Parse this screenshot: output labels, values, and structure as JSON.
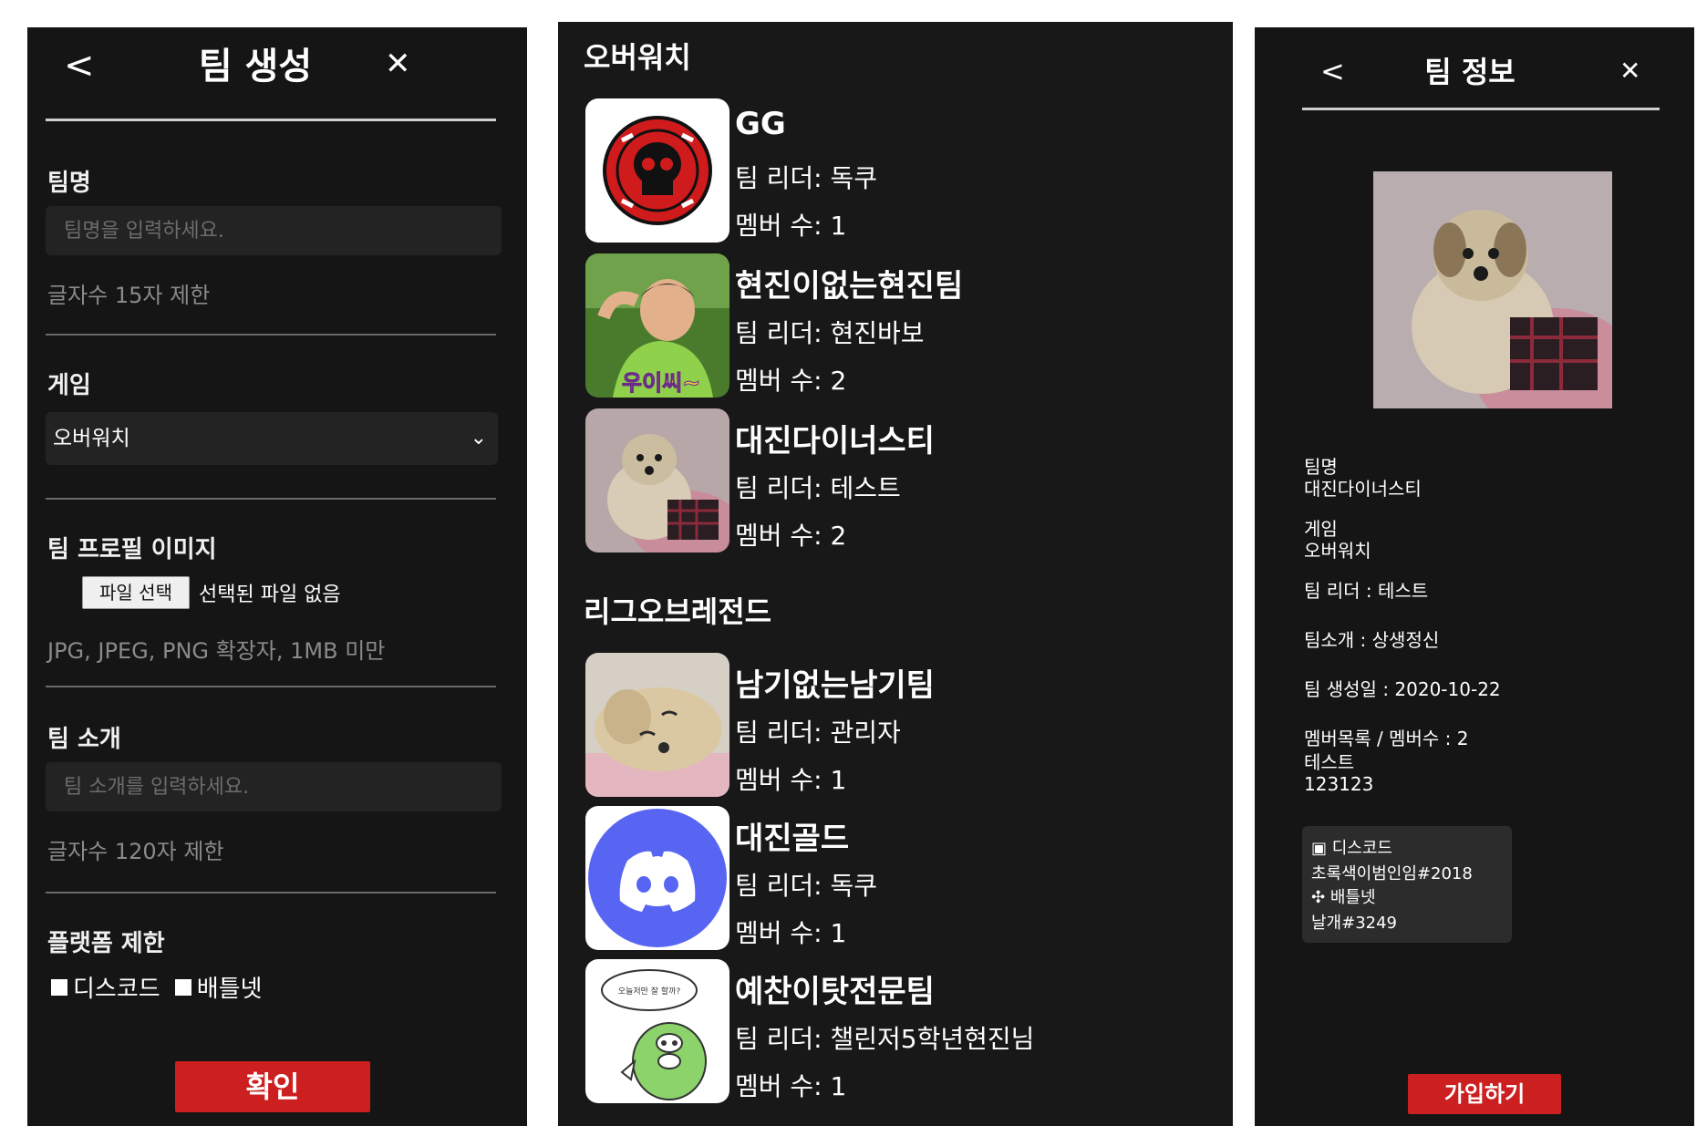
{
  "create": {
    "title": "팀 생성",
    "back": "<",
    "close": "✕",
    "name_label": "팀명",
    "name_placeholder": "팀명을 입력하세요.",
    "name_hint": "글자수 15자 제한",
    "game_label": "게임",
    "game_selected": "오버워치",
    "image_label": "팀 프로필 이미지",
    "file_button": "파일 선택",
    "file_status": "선택된 파일 없음",
    "image_hint": "JPG, JPEG, PNG 확장자, 1MB 미만",
    "intro_label": "팀 소개",
    "intro_placeholder": "팀 소개를 입력하세요.",
    "intro_hint": "글자수 120자 제한",
    "platform_label": "플랫폼 제한",
    "platform_discord": "디스코드",
    "platform_battlenet": "배틀넷",
    "confirm": "확인"
  },
  "list": {
    "sections": [
      {
        "title": "오버워치",
        "teams": [
          {
            "name": "GG",
            "leader": "팀 리더: 독쿠",
            "members": "멤버 수: 1",
            "thumb": "red-skull-logo"
          },
          {
            "name": "현진이없는현진팀",
            "leader": "팀 리더: 현진바보",
            "members": "멤버 수: 2",
            "thumb": "person-photo"
          },
          {
            "name": "대진다이너스티",
            "leader": "팀 리더: 테스트",
            "members": "멤버 수: 2",
            "thumb": "dog-photo"
          }
        ]
      },
      {
        "title": "리그오브레전드",
        "teams": [
          {
            "name": "남기없는남기팀",
            "leader": "팀 리더: 관리자",
            "members": "멤버 수: 1",
            "thumb": "dog-lying-photo"
          },
          {
            "name": "대진골드",
            "leader": "팀 리더: 독쿠",
            "members": "멤버 수: 1",
            "thumb": "discord-logo"
          },
          {
            "name": "예찬이탓전문팀",
            "leader": "팀 리더: 챌린저5학년현진님",
            "members": "멤버 수: 1",
            "thumb": "green-cartoon"
          }
        ]
      }
    ],
    "thumb_person_caption": "우이씨~",
    "cartoon_bubble": "오늘저만 잘 할까?"
  },
  "info": {
    "title": "팀 정보",
    "back": "<",
    "close": "✕",
    "name_label": "팀명",
    "name_value": "대진다이너스티",
    "game_label": "게임",
    "game_value": "오버워치",
    "leader": "팀 리더 : 테스트",
    "intro": "팀소개 : 상생정신",
    "created": "팀 생성일 : 2020-10-22",
    "members_header": "멤버목록 / 멤버수 : 2",
    "member_1": "테스트",
    "member_2": "123123",
    "discord_label": "디스코드",
    "discord_id": "초록색이범인임#2018",
    "battlenet_label": "배틀넷",
    "battlenet_id": "날개#3249",
    "join": "가입하기"
  },
  "colors": {
    "panel_bg": "#151515",
    "accent_red": "#cc1f1f",
    "discord_blue": "#5865f2"
  }
}
